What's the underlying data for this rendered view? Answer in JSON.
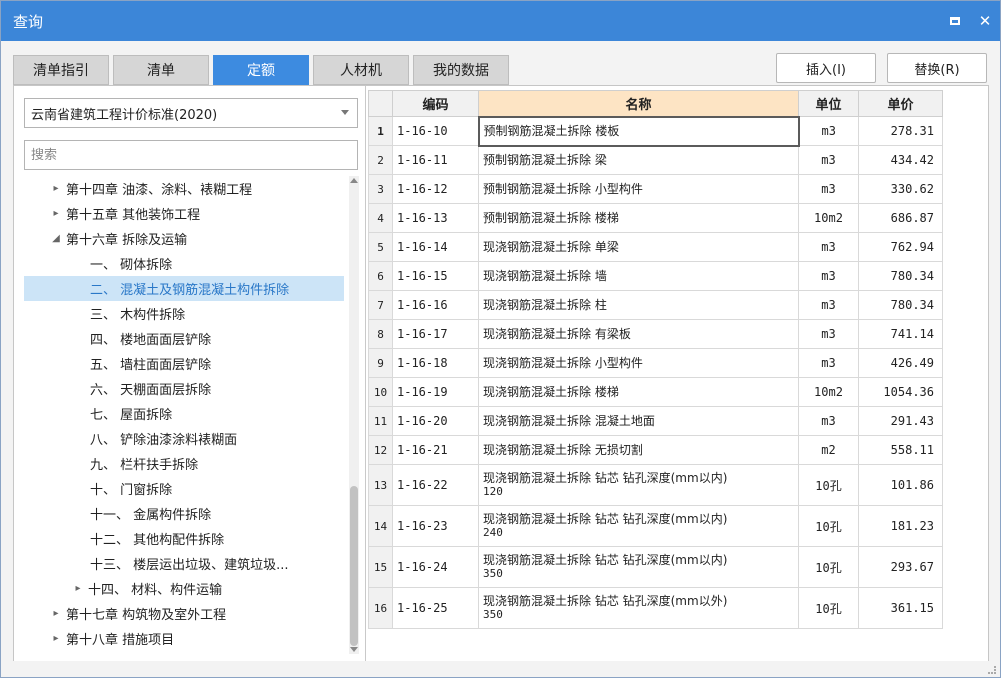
{
  "window": {
    "title": "查询"
  },
  "tabs": [
    {
      "label": "清单指引",
      "active": false
    },
    {
      "label": "清单",
      "active": false
    },
    {
      "label": "定额",
      "active": true
    },
    {
      "label": "人材机",
      "active": false
    },
    {
      "label": "我的数据",
      "active": false
    }
  ],
  "actions": {
    "insert_label": "插入(I)",
    "replace_label": "替换(R)"
  },
  "dropdown": {
    "value": "云南省建筑工程计价标准(2020)"
  },
  "search": {
    "placeholder": "搜索"
  },
  "tree": [
    {
      "label": "第十四章 油漆、涂料、裱糊工程",
      "level": 0,
      "caret": "right"
    },
    {
      "label": "第十五章 其他装饰工程",
      "level": 0,
      "caret": "right"
    },
    {
      "label": "第十六章 拆除及运输",
      "level": 0,
      "caret": "down"
    },
    {
      "label": "一、 砌体拆除",
      "level": 1,
      "caret": ""
    },
    {
      "label": "二、 混凝土及钢筋混凝土构件拆除",
      "level": 1,
      "caret": "",
      "selected": true
    },
    {
      "label": "三、 木构件拆除",
      "level": 1,
      "caret": ""
    },
    {
      "label": "四、 楼地面面层铲除",
      "level": 1,
      "caret": ""
    },
    {
      "label": "五、 墙柱面面层铲除",
      "level": 1,
      "caret": ""
    },
    {
      "label": "六、 天棚面面层拆除",
      "level": 1,
      "caret": ""
    },
    {
      "label": "七、 屋面拆除",
      "level": 1,
      "caret": ""
    },
    {
      "label": "八、 铲除油漆涂料裱糊面",
      "level": 1,
      "caret": ""
    },
    {
      "label": "九、 栏杆扶手拆除",
      "level": 1,
      "caret": ""
    },
    {
      "label": "十、 门窗拆除",
      "level": 1,
      "caret": ""
    },
    {
      "label": "十一、 金属构件拆除",
      "level": 1,
      "caret": ""
    },
    {
      "label": "十二、 其他构配件拆除",
      "level": 1,
      "caret": ""
    },
    {
      "label": "十三、 楼层运出垃圾、建筑垃圾...",
      "level": 1,
      "caret": ""
    },
    {
      "label": "十四、 材料、构件运输",
      "level": 1,
      "caret": "right"
    },
    {
      "label": "第十七章 构筑物及室外工程",
      "level": 0,
      "caret": "right"
    },
    {
      "label": "第十八章 措施项目",
      "level": 0,
      "caret": "right"
    }
  ],
  "grid": {
    "headers": {
      "code": "编码",
      "name": "名称",
      "unit": "单位",
      "price": "单价"
    },
    "rows": [
      {
        "idx": "1",
        "code": "1-16-10",
        "name": "预制钢筋混凝土拆除 楼板",
        "sub": "",
        "unit": "m3",
        "price": "278.31"
      },
      {
        "idx": "2",
        "code": "1-16-11",
        "name": "预制钢筋混凝土拆除 梁",
        "sub": "",
        "unit": "m3",
        "price": "434.42"
      },
      {
        "idx": "3",
        "code": "1-16-12",
        "name": "预制钢筋混凝土拆除 小型构件",
        "sub": "",
        "unit": "m3",
        "price": "330.62"
      },
      {
        "idx": "4",
        "code": "1-16-13",
        "name": "预制钢筋混凝土拆除 楼梯",
        "sub": "",
        "unit": "10m2",
        "price": "686.87"
      },
      {
        "idx": "5",
        "code": "1-16-14",
        "name": "现浇钢筋混凝土拆除 单梁",
        "sub": "",
        "unit": "m3",
        "price": "762.94"
      },
      {
        "idx": "6",
        "code": "1-16-15",
        "name": "现浇钢筋混凝土拆除 墙",
        "sub": "",
        "unit": "m3",
        "price": "780.34"
      },
      {
        "idx": "7",
        "code": "1-16-16",
        "name": "现浇钢筋混凝土拆除 柱",
        "sub": "",
        "unit": "m3",
        "price": "780.34"
      },
      {
        "idx": "8",
        "code": "1-16-17",
        "name": "现浇钢筋混凝土拆除 有梁板",
        "sub": "",
        "unit": "m3",
        "price": "741.14"
      },
      {
        "idx": "9",
        "code": "1-16-18",
        "name": "现浇钢筋混凝土拆除 小型构件",
        "sub": "",
        "unit": "m3",
        "price": "426.49"
      },
      {
        "idx": "10",
        "code": "1-16-19",
        "name": "现浇钢筋混凝土拆除 楼梯",
        "sub": "",
        "unit": "10m2",
        "price": "1054.36"
      },
      {
        "idx": "11",
        "code": "1-16-20",
        "name": "现浇钢筋混凝土拆除 混凝土地面",
        "sub": "",
        "unit": "m3",
        "price": "291.43"
      },
      {
        "idx": "12",
        "code": "1-16-21",
        "name": "现浇钢筋混凝土拆除 无损切割",
        "sub": "",
        "unit": "m2",
        "price": "558.11"
      },
      {
        "idx": "13",
        "code": "1-16-22",
        "name": "现浇钢筋混凝土拆除 钻芯 钻孔深度(mm以内)",
        "sub": "120",
        "unit": "10孔",
        "price": "101.86"
      },
      {
        "idx": "14",
        "code": "1-16-23",
        "name": "现浇钢筋混凝土拆除 钻芯 钻孔深度(mm以内)",
        "sub": "240",
        "unit": "10孔",
        "price": "181.23"
      },
      {
        "idx": "15",
        "code": "1-16-24",
        "name": "现浇钢筋混凝土拆除 钻芯 钻孔深度(mm以内)",
        "sub": "350",
        "unit": "10孔",
        "price": "293.67"
      },
      {
        "idx": "16",
        "code": "1-16-25",
        "name": "现浇钢筋混凝土拆除 钻芯 钻孔深度(mm以外)",
        "sub": "350",
        "unit": "10孔",
        "price": "361.15"
      }
    ]
  }
}
